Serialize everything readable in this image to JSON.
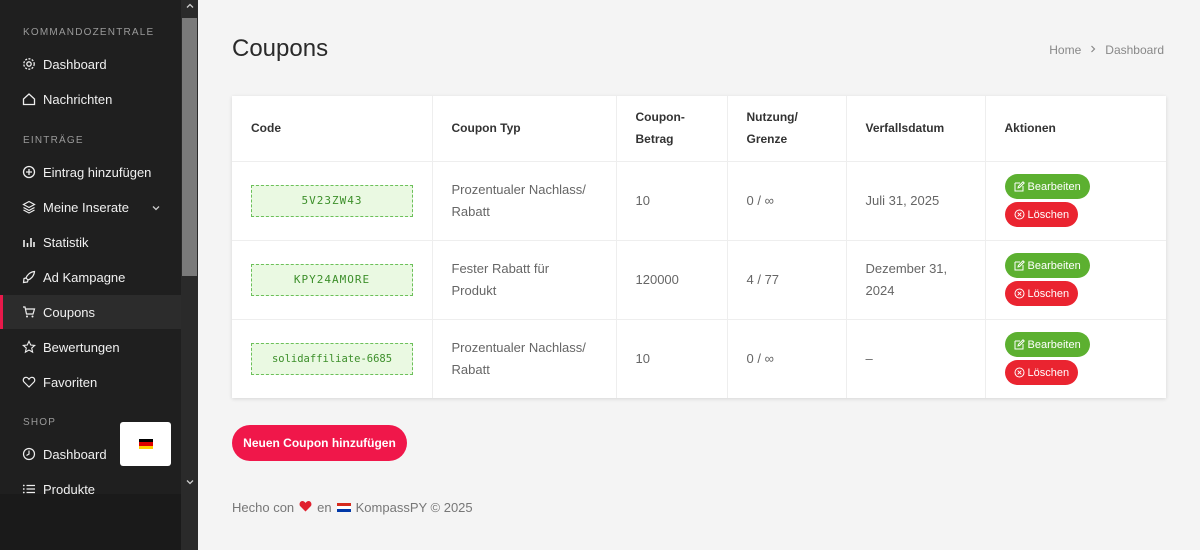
{
  "sidebar": {
    "sections": {
      "kommandozentrale": "KOMMANDOZENTRALE",
      "eintraege": "EINTRÄGE",
      "shop": "SHOP"
    },
    "items": {
      "dashboard": "Dashboard",
      "nachrichten": "Nachrichten",
      "eintrag_hinzufuegen": "Eintrag hinzufügen",
      "meine_inserate": "Meine Inserate",
      "statistik": "Statistik",
      "ad_kampagne": "Ad Kampagne",
      "coupons": "Coupons",
      "bewertungen": "Bewertungen",
      "favoriten": "Favoriten",
      "shop_dashboard": "Dashboard",
      "produkte": "Produkte"
    },
    "active_item": "coupons"
  },
  "header": {
    "title": "Coupons",
    "breadcrumb": [
      "Home",
      "Dashboard"
    ]
  },
  "table": {
    "columns": {
      "code": "Code",
      "type": "Coupon Typ",
      "amount_line1": "Coupon-",
      "amount_line2": "Betrag",
      "usage_line1": "Nutzung/",
      "usage_line2": "Grenze",
      "expiry": "Verfallsdatum",
      "actions": "Aktionen"
    },
    "rows": [
      {
        "code": "5V23ZW43",
        "type_line1": "Prozentualer Nachlass/",
        "type_line2": "Rabatt",
        "amount": "10",
        "usage": "0 / ∞",
        "expiry_line1": "Juli 31, 2025",
        "expiry_line2": ""
      },
      {
        "code": "KPY24AMORE",
        "type_line1": "Fester Rabatt für",
        "type_line2": "Produkt",
        "amount": "120000",
        "usage": "4 / 77",
        "expiry_line1": "Dezember 31,",
        "expiry_line2": "2024"
      },
      {
        "code": "solidaffiliate-6685",
        "type_line1": "Prozentualer Nachlass/",
        "type_line2": "Rabatt",
        "amount": "10",
        "usage": "0 / ∞",
        "expiry_line1": "–",
        "expiry_line2": ""
      }
    ],
    "edit_label": "Bearbeiten",
    "delete_label": "Löschen"
  },
  "add_button": "Neuen Coupon hinzufügen",
  "footer": {
    "part1": "Hecho con",
    "part2": "en",
    "part3": "KompassPY © 2025"
  },
  "colors": {
    "accent": "#f0174a",
    "edit": "#5cb030",
    "delete": "#ea2430",
    "code_border": "#6cc05a"
  },
  "icons": [
    "gear-icon",
    "home-icon",
    "plus-circle-icon",
    "layers-icon",
    "bar-chart-icon",
    "rocket-icon",
    "cart-icon",
    "star-icon",
    "heart-icon",
    "clock-icon",
    "list-icon",
    "edit-icon",
    "x-circle-icon"
  ]
}
